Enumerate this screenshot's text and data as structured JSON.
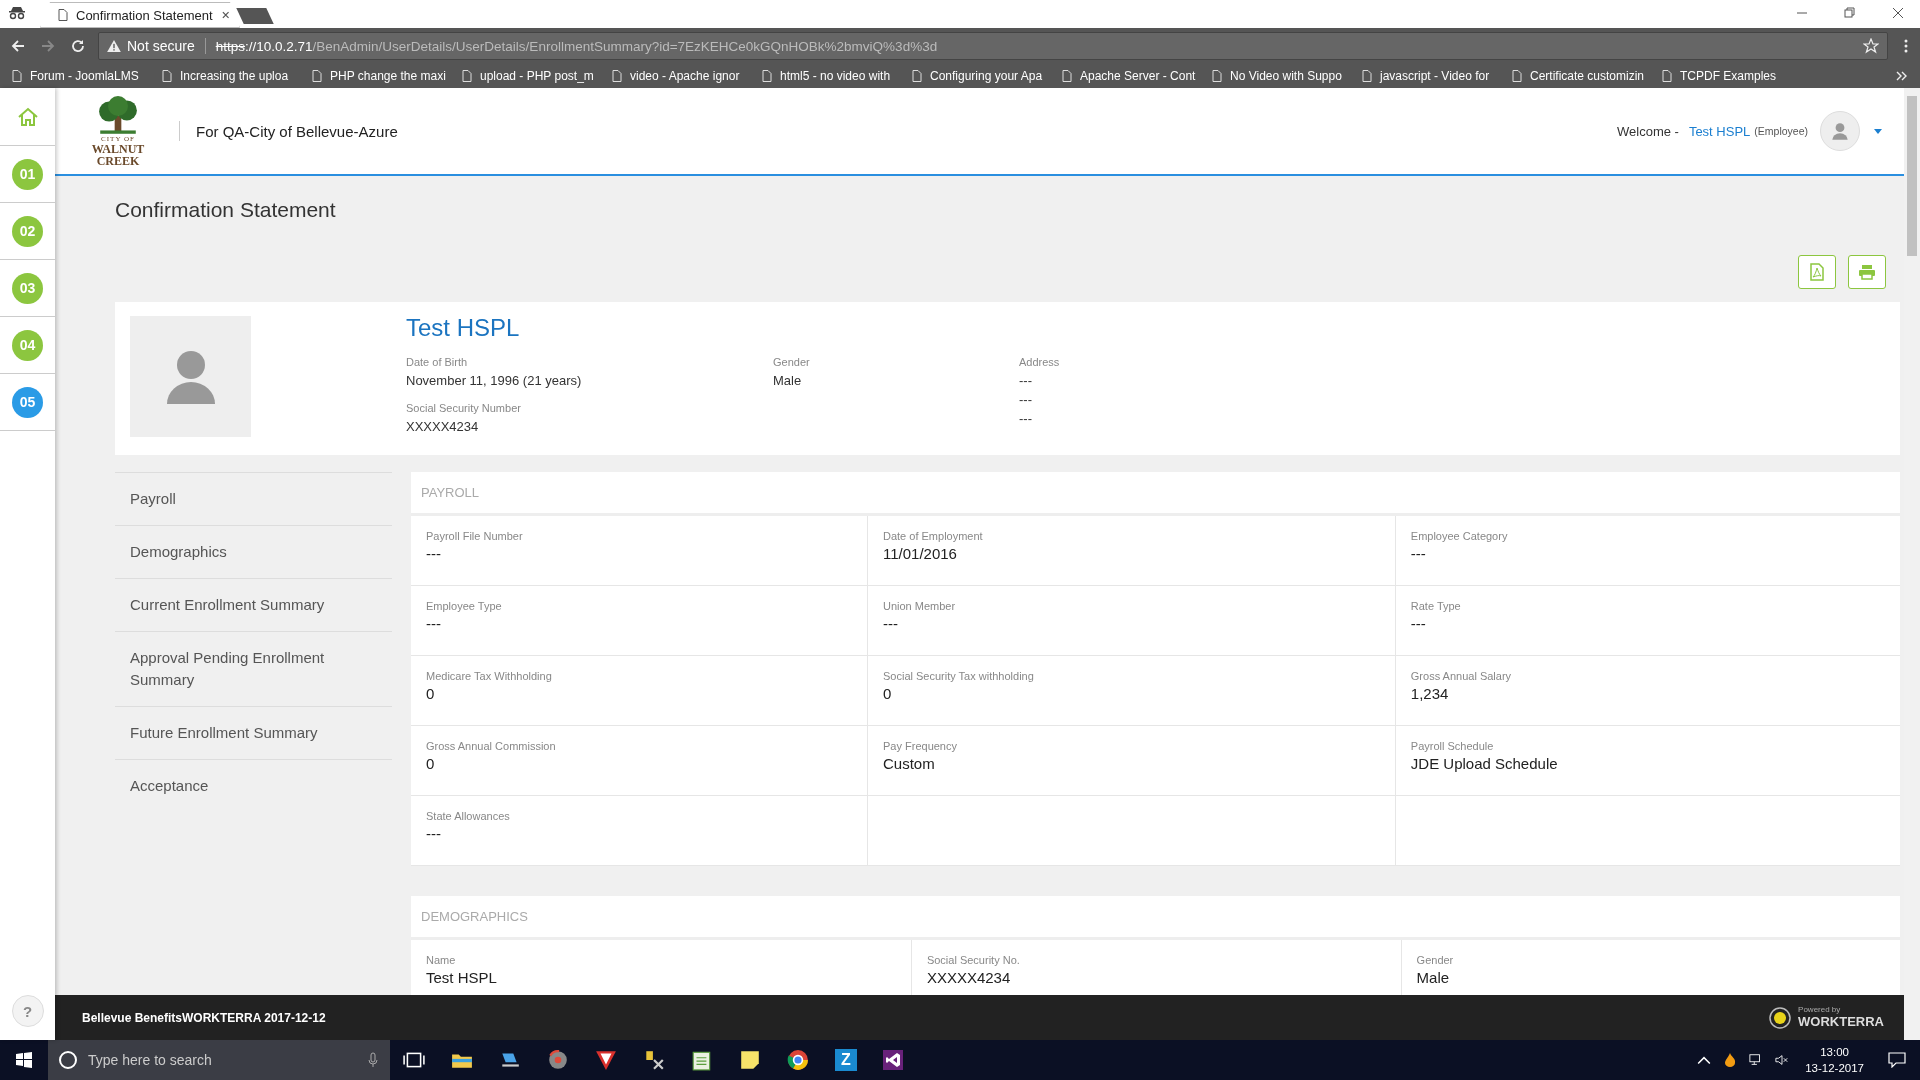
{
  "browser": {
    "tabs": [
      {
        "title": "Confirmation Statement",
        "selected": true
      }
    ],
    "security": "Not secure",
    "url_scheme": "https",
    "url_host": "://10.0.2.71",
    "url_path": "/BenAdmin/UserDetails/UserDetails/EnrollmentSummary?id=7EzKEHCe0kGQnHOBk%2bmviQ%3d%3d",
    "bookmarks": [
      "Forum - JoomlaLMS",
      "Increasing the uploa",
      "PHP change the maxi",
      "upload - PHP post_m",
      "video - Apache ignor",
      "html5 - no video with",
      "Configuring your Apa",
      "Apache Server - Cont",
      "No Video with Suppo",
      "javascript - Video for",
      "Certificate customizin",
      "TCPDF Examples"
    ]
  },
  "rail": {
    "steps": [
      {
        "label": "01",
        "selected": false
      },
      {
        "label": "02",
        "selected": false
      },
      {
        "label": "03",
        "selected": false
      },
      {
        "label": "04",
        "selected": false
      },
      {
        "label": "05",
        "selected": true
      }
    ],
    "help": "?"
  },
  "header": {
    "logo_lines": [
      "CITY OF",
      "WALNUT",
      "CREEK"
    ],
    "org": "For QA-City of Bellevue-Azure",
    "welcome": "Welcome -",
    "user": "Test HSPL",
    "role": "(Employee)"
  },
  "page_title": "Confirmation Statement",
  "profile": {
    "name": "Test HSPL",
    "fields": [
      {
        "label": "Date of Birth",
        "values": [
          "November 11, 1996 (21 years)"
        ]
      },
      {
        "label": "Gender",
        "values": [
          "Male"
        ]
      },
      {
        "label": "Address",
        "values": [
          "---",
          "---",
          "---"
        ]
      },
      {
        "label": "Social Security Number",
        "values": [
          "XXXXX4234"
        ]
      }
    ]
  },
  "nav": [
    "Payroll",
    "Demographics",
    "Current Enrollment Summary",
    "Approval Pending Enrollment Summary",
    "Future Enrollment Summary",
    "Acceptance"
  ],
  "sections": [
    {
      "kind": "payroll",
      "title": "PAYROLL",
      "fields": [
        {
          "label": "Payroll File Number",
          "value": "---"
        },
        {
          "label": "Date of Employment",
          "value": "11/01/2016"
        },
        {
          "label": "Employee Category",
          "value": "---"
        },
        {
          "label": "Employee Type",
          "value": "---"
        },
        {
          "label": "Union Member",
          "value": "---"
        },
        {
          "label": "Rate Type",
          "value": "---"
        },
        {
          "label": "Medicare Tax Withholding",
          "value": "0"
        },
        {
          "label": "Social Security Tax withholding",
          "value": "0"
        },
        {
          "label": "Gross Annual Salary",
          "value": "1,234"
        },
        {
          "label": "Gross Annual Commission",
          "value": "0"
        },
        {
          "label": "Pay Frequency",
          "value": "Custom"
        },
        {
          "label": "Payroll Schedule",
          "value": "JDE Upload Schedule"
        },
        {
          "label": "State Allowances",
          "value": "---"
        }
      ]
    },
    {
      "kind": "demographics",
      "title": "DEMOGRAPHICS",
      "fields": [
        {
          "label": "Name",
          "value": "Test HSPL"
        },
        {
          "label": "Social Security No.",
          "value": "XXXXX4234"
        },
        {
          "label": "Gender",
          "value": "Male"
        }
      ]
    }
  ],
  "footer": {
    "text": "Bellevue BenefitsWORKTERRA 2017-12-12",
    "powered_by": "Powered by",
    "brand": "WORKTERRA"
  },
  "taskbar": {
    "search_placeholder": "Type here to search",
    "z_app": "Z",
    "time": "13:00",
    "date": "13-12-2017"
  }
}
